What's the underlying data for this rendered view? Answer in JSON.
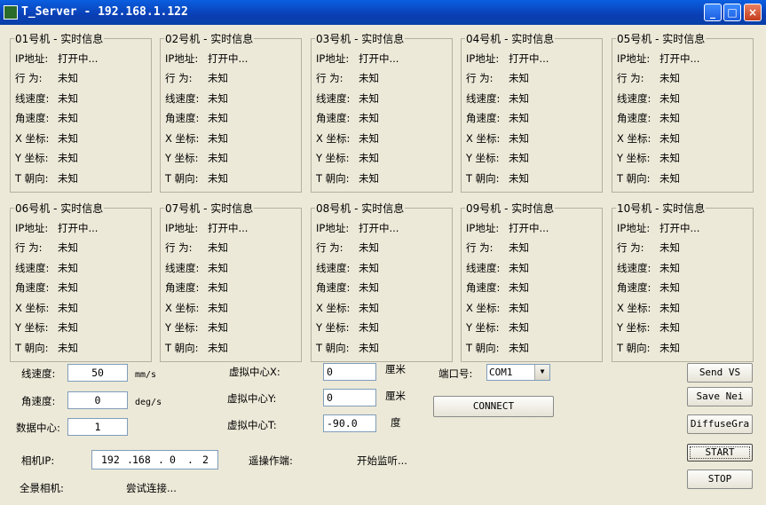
{
  "window": {
    "title": "T_Server - 192.168.1.122"
  },
  "groups": [
    {
      "title": "01号机 - 实时信息"
    },
    {
      "title": "02号机 - 实时信息"
    },
    {
      "title": "03号机 - 实时信息"
    },
    {
      "title": "04号机 - 实时信息"
    },
    {
      "title": "05号机 - 实时信息"
    },
    {
      "title": "06号机 - 实时信息"
    },
    {
      "title": "07号机 - 实时信息"
    },
    {
      "title": "08号机 - 实时信息"
    },
    {
      "title": "09号机 - 实时信息"
    },
    {
      "title": "10号机 - 实时信息"
    }
  ],
  "group_rows": [
    {
      "label": "IP地址:",
      "value": "打开中..."
    },
    {
      "label": "行  为:",
      "value": "未知"
    },
    {
      "label": "线速度:",
      "value": "未知"
    },
    {
      "label": "角速度:",
      "value": "未知"
    },
    {
      "label": "X 坐标:",
      "value": "未知"
    },
    {
      "label": "Y 坐标:",
      "value": "未知"
    },
    {
      "label": "T 朝向:",
      "value": "未知"
    }
  ],
  "controls": {
    "linear_speed_label": "线速度:",
    "linear_speed_value": "50",
    "linear_speed_unit": "mm/s",
    "angular_speed_label": "角速度:",
    "angular_speed_value": "0",
    "angular_speed_unit": "deg/s",
    "data_center_label": "数据中心:",
    "data_center_value": "1",
    "vx_label": "虚拟中心X:",
    "vx_value": "0",
    "vx_unit": "厘米",
    "vy_label": "虚拟中心Y:",
    "vy_value": "0",
    "vy_unit": "厘米",
    "vt_label": "虚拟中心T:",
    "vt_value": "-90.0",
    "vt_unit": "度",
    "port_label": "端口号:",
    "port_value": "COM1",
    "connect_label": "CONNECT",
    "camera_ip_label": "相机IP:",
    "camera_ip": [
      "192",
      "168",
      "0",
      "2"
    ],
    "remote_label": "遥操作端:",
    "remote_status": "开始监听...",
    "pano_label": "全景相机:",
    "pano_status": "尝试连接..."
  },
  "buttons": {
    "send_vs": "Send VS",
    "save_nei": "Save Nei",
    "diffuse": "DiffuseGra",
    "start": "START",
    "stop": "STOP"
  },
  "titlebar_buttons": {
    "min": "_",
    "max": "□",
    "close": "×"
  }
}
